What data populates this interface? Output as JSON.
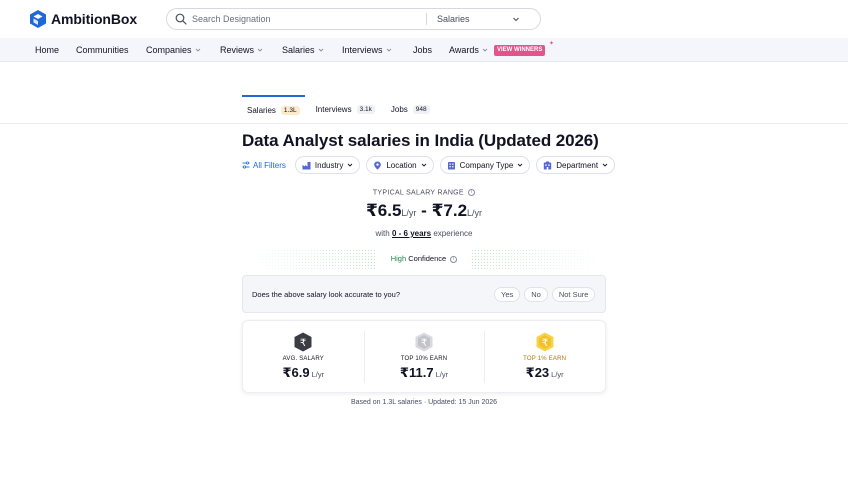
{
  "header": {
    "brand": "AmbitionBox",
    "search_placeholder": "Search Designation",
    "search_type": "Salaries"
  },
  "nav": {
    "items": [
      {
        "label": "Home"
      },
      {
        "label": "Communities"
      },
      {
        "label": "Companies"
      },
      {
        "label": "Reviews"
      },
      {
        "label": "Salaries"
      },
      {
        "label": "Interviews"
      },
      {
        "label": "Jobs"
      },
      {
        "label": "Awards"
      }
    ],
    "winners_badge": "VIEW WINNERS"
  },
  "tabs": [
    {
      "label": "Salaries",
      "count": "1.3L",
      "active": true
    },
    {
      "label": "Interviews",
      "count": "3.1k"
    },
    {
      "label": "Jobs",
      "count": "948"
    }
  ],
  "page": {
    "title": "Data Analyst salaries in India (Updated 2026)"
  },
  "filters": {
    "all_label": "All Filters",
    "chips": [
      "Industry",
      "Location",
      "Company Type",
      "Department"
    ]
  },
  "range": {
    "label": "TYPICAL SALARY RANGE",
    "min": "₹6.5",
    "max": "₹7.2",
    "unit": "L/yr",
    "separator": "-",
    "exp_prefix": "with",
    "exp_years": "0 - 6 years",
    "exp_suffix": "experience",
    "confidence_level": "High",
    "confidence_word": "Confidence"
  },
  "feedback": {
    "question": "Does the above salary look accurate to you?",
    "options": [
      "Yes",
      "No",
      "Not Sure"
    ]
  },
  "stats": [
    {
      "label": "AVG. SALARY",
      "value": "₹6.9",
      "unit": "L/yr",
      "icon": "rupee-dark-hex-icon"
    },
    {
      "label": "TOP 10% EARN",
      "value": "₹11.7",
      "unit": "L/yr",
      "icon": "rupee-silver-hex-icon"
    },
    {
      "label": "TOP 1% EARN",
      "value": "₹23",
      "unit": "L/yr",
      "icon": "rupee-gold-hex-icon"
    }
  ],
  "footer_note": "Based on 1.3L salaries · Updated: 15 Jun 2026",
  "colors": {
    "accent": "#1e68d9",
    "brand_pink": "#e5538c",
    "confidence_green": "#1e8a49",
    "gold": "#f2c12e"
  }
}
